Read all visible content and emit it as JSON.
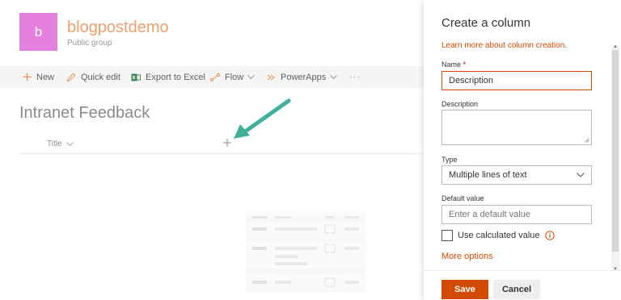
{
  "site": {
    "logo_letter": "b",
    "name": "blogpostdemo",
    "subtitle": "Public group",
    "logo_color": "#e06ad8",
    "name_color": "#ea8f58"
  },
  "commandbar": {
    "new_label": "New",
    "quick_edit_label": "Quick edit",
    "export_label": "Export to Excel",
    "flow_label": "Flow",
    "powerapps_label": "PowerApps",
    "more_label": "···"
  },
  "list": {
    "title": "Intranet Feedback",
    "columns": [
      "Title"
    ]
  },
  "panel": {
    "title": "Create a column",
    "learn_more": "Learn more about column creation.",
    "name_label": "Name",
    "required_mark": "*",
    "name_value": "Description",
    "description_label": "Description",
    "type_label": "Type",
    "type_value": "Multiple lines of text",
    "default_label": "Default value",
    "default_placeholder": "Enter a default value",
    "calculated_label": "Use calculated value",
    "more_options": "More options",
    "save_label": "Save",
    "cancel_label": "Cancel",
    "accent_color": "#d04a02"
  }
}
